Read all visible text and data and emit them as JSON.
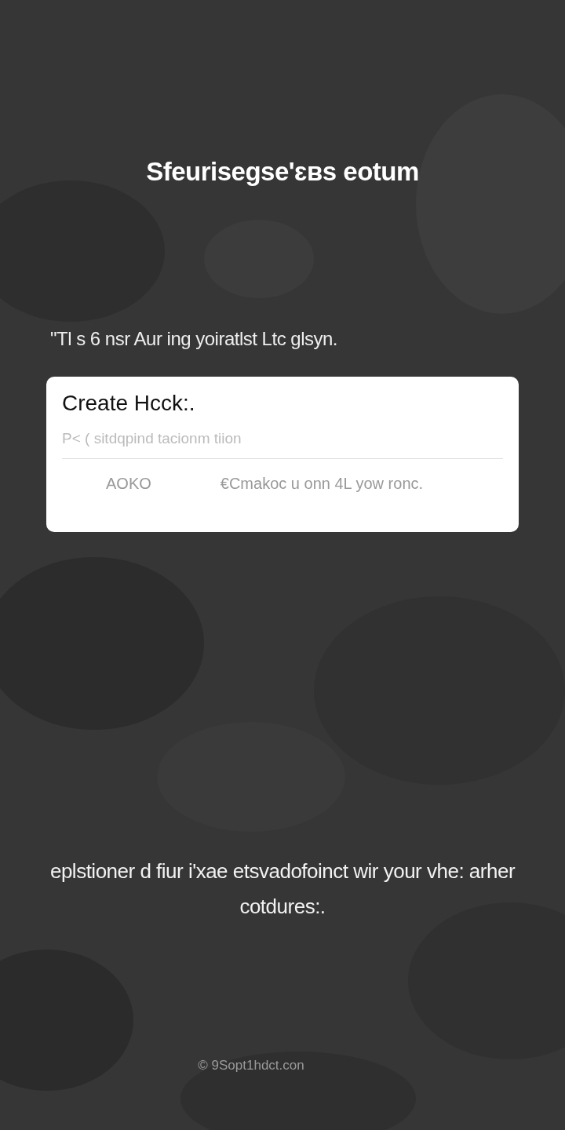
{
  "title": "Sfeurisegse'ɛʙs eotum",
  "subtitle": "\"Tl s 6 nsr Aur ing yoiratlst Ltc glsyn.",
  "dialog": {
    "title": "Create Hcck:.",
    "field": {
      "placeholder": "P< ( sitdqpind tacionm tiion"
    },
    "buttons": [
      "AOKO",
      "€Cmakoc u onn 4L yow ronc."
    ]
  },
  "message": "eplstioner d fiur i'xae etsvadofoinct wir your vhe: arher cotdures:.",
  "footer": "© 9Sopt1hdct.con"
}
